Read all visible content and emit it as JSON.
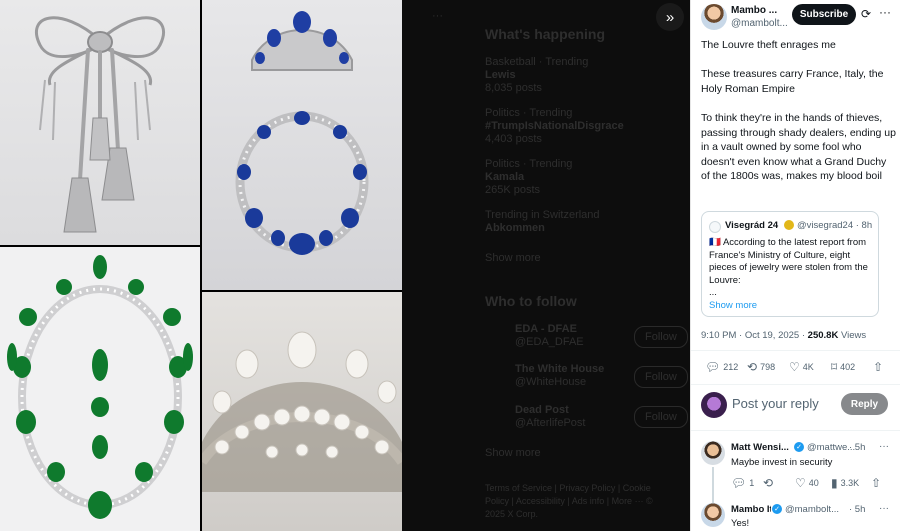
{
  "gallery": {
    "tiles": [
      "bow-brooch",
      "sapphire-tiara-necklace",
      "emerald-necklace",
      "pearl-tiara"
    ]
  },
  "timeline": {
    "whats_happening_title": "What's happening",
    "trends": [
      {
        "context": "Basketball · Trending",
        "topic": "Lewis",
        "posts": "8,035 posts"
      },
      {
        "context": "Politics · Trending",
        "topic": "#TrumpIsNationalDisgrace",
        "posts": "4,403 posts"
      },
      {
        "context": "Politics · Trending",
        "topic": "Kamala",
        "posts": "265K posts"
      },
      {
        "context": "Trending in Switzerland",
        "topic": "Abkommen",
        "posts": ""
      }
    ],
    "show_more": "Show more",
    "who_to_follow_title": "Who to follow",
    "follow_suggestions": [
      {
        "name": "EDA - DFAE",
        "handle": "@EDA_DFAE",
        "button": "Follow"
      },
      {
        "name": "The White House",
        "handle": "@WhiteHouse",
        "button": "Follow"
      },
      {
        "name": "Dead Post",
        "handle": "@AfterlifePost",
        "button": "Follow"
      }
    ],
    "show_more_2": "Show more",
    "footer": "Terms of Service | Privacy Policy | Cookie Policy | Accessibility | Ads info | More ··· © 2025 X Corp."
  },
  "post": {
    "author_name": "Mambo ...",
    "author_handle": "@mambolt...",
    "subscribe_label": "Subscribe",
    "paragraphs": [
      "The Louvre theft enrages me",
      "These treasures carry France, Italy, the Holy Roman Empire",
      "To think they're in the hands of thieves, passing through shady dealers, ending up in a vault owned by some fool who doesn't even know what a Grand Duchy of the 1800s was, makes my blood boil"
    ],
    "quote": {
      "name": "Visegrád 24",
      "handle": "@visegrad24 · 8h",
      "text": "🇫🇷 According to the latest report from France's Ministry of Culture, eight pieces of jewelry were stolen from the Louvre:",
      "ellipsis": "...",
      "show_more": "Show more"
    },
    "time": "9:10 PM · Oct 19, 2025 · ",
    "views_count": "250.8K",
    "views_label": " Views",
    "actions": {
      "replies": "212",
      "reposts": "798",
      "likes": "4K",
      "bookmarks": "402"
    }
  },
  "reply_box": {
    "placeholder": "Post your reply",
    "button": "Reply"
  },
  "replies": [
    {
      "name": "Matt Wensi...",
      "handle": "@mattwe...",
      "time": "· 5h",
      "text": "Maybe invest in security",
      "replies": "1",
      "reposts": "",
      "likes": "40",
      "views": "3.3K"
    },
    {
      "name": "Mambo It...",
      "handle": "@mambolt...",
      "time": "· 5h",
      "text": "Yes!"
    }
  ],
  "colors": {
    "accent": "#1d9bf0",
    "text": "#0f1419",
    "muted": "#536471",
    "emerald": "#0f7a2d",
    "sapphire": "#1a3a9a"
  },
  "icons": {
    "expand": "double-chevron-right-icon",
    "more": "ellipsis-icon",
    "refresh": "refresh-icon"
  }
}
